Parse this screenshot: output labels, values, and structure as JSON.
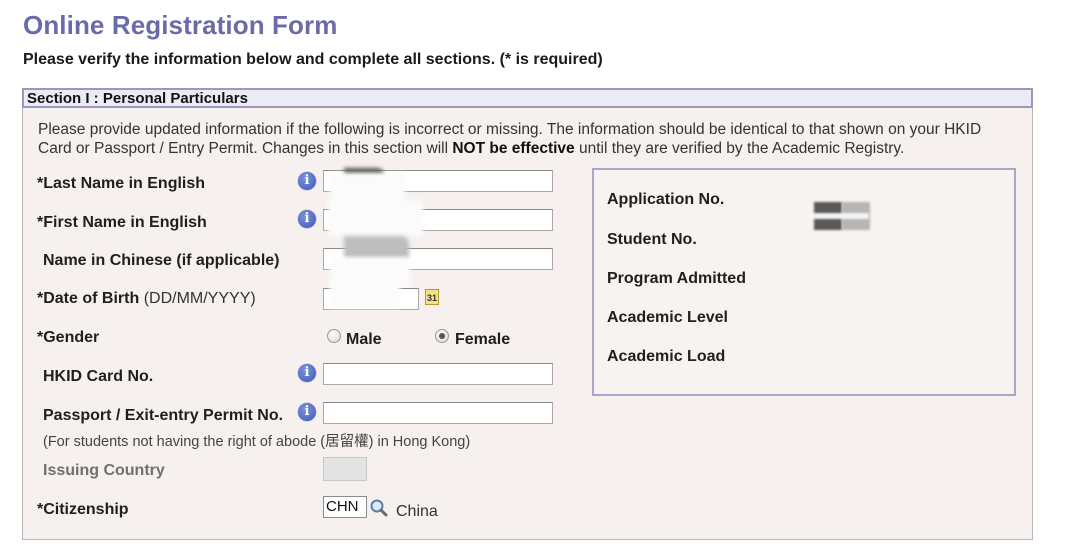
{
  "page": {
    "title": "Online Registration Form",
    "subtitle": "Please verify the information below and complete all sections. (* is required)"
  },
  "section1": {
    "header": "Section I : Personal Particulars",
    "intro_part1": "Please provide updated information if the following is incorrect or missing. The information should be identical to that shown on your HKID Card or Passport / Entry Permit. Changes in this section will ",
    "intro_bold": "NOT be effective",
    "intro_part2": " until they are verified by the Academic Registry.",
    "fields": {
      "last_name": {
        "label": "*Last Name in English",
        "value": ""
      },
      "first_name": {
        "label": "*First Name in English",
        "value": ""
      },
      "chinese_name": {
        "label": "Name in Chinese (if applicable)",
        "value": ""
      },
      "dob": {
        "label": "*Date of Birth",
        "format_hint": "(DD/MM/YYYY)",
        "value": "",
        "calendar_icon_text": "31"
      },
      "gender": {
        "label": "*Gender",
        "options": [
          "Male",
          "Female"
        ],
        "selected": "Female"
      },
      "hkid": {
        "label": "HKID Card No.",
        "value": ""
      },
      "passport": {
        "label": "Passport / Exit-entry Permit No.",
        "value": "",
        "note": "(For students not having the right of abode (居留權) in Hong Kong)"
      },
      "issuing_country": {
        "label": "Issuing Country",
        "value": ""
      },
      "citizenship": {
        "label": "*Citizenship",
        "code": "CHN",
        "description": "China"
      }
    },
    "academic_info": {
      "application_no": "Application No.",
      "student_no": "Student No.",
      "program_admitted": "Program Admitted",
      "academic_level": "Academic Level",
      "academic_load": "Academic Load"
    }
  },
  "icons": {
    "info": "i"
  }
}
